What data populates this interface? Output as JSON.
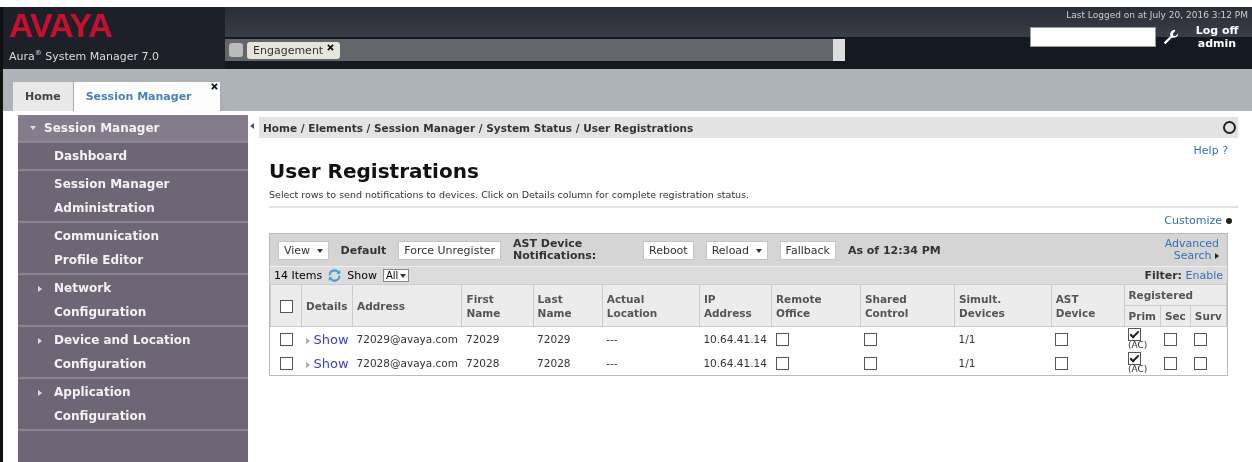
{
  "header": {
    "logo": "AVAYA",
    "product": "Aura",
    "product_mark": "®",
    "product_rest": " System Manager 7.0",
    "tabs": [
      {
        "label": "Engagement"
      }
    ],
    "last_login": "Last Logged on at July 20, 2016 3:12 PM",
    "logoff": "Log off",
    "user": "admin"
  },
  "tabs": [
    {
      "label": "Home",
      "selected": false,
      "closable": false
    },
    {
      "label": "Session Manager",
      "selected": true,
      "closable": true
    }
  ],
  "sidebar": {
    "items": [
      {
        "label": "Session Manager",
        "kind": "group",
        "expanded": true
      },
      {
        "label": "Dashboard",
        "kind": "item"
      },
      {
        "label": "Session Manager Administration",
        "kind": "item"
      },
      {
        "label": "Communication Profile Editor",
        "kind": "item"
      },
      {
        "label": "Network Configuration",
        "kind": "group",
        "expanded": false
      },
      {
        "label": "Device and Location Configuration",
        "kind": "group",
        "expanded": false
      },
      {
        "label": "Application Configuration",
        "kind": "group",
        "expanded": false
      }
    ]
  },
  "breadcrumb": "Home / Elements / Session Manager / System Status / User Registrations",
  "help": "Help ?",
  "title": "User Registrations",
  "description": "Select rows to send notifications to devices. Click on Details column for complete registration status.",
  "customize": "Customize",
  "toolbar": {
    "view": "View",
    "default": "Default",
    "force": "Force Unregister",
    "ast_label": "AST Device Notifications:",
    "reboot": "Reboot",
    "reload": "Reload",
    "failback": "Fallback",
    "as_of": "As of 12:34 PM",
    "advanced": "Advanced Search"
  },
  "items_bar": {
    "count": "14 Items",
    "show": "Show",
    "show_value": "All",
    "filter": "Filter:",
    "filter_link": "Enable"
  },
  "table": {
    "select_all": false,
    "columns": [
      "Details",
      "Address",
      "First Name",
      "Last Name",
      "Actual Location",
      "IP Address",
      "Remote Office",
      "Shared Control",
      "Simult. Devices",
      "AST Device"
    ],
    "registered": "Registered",
    "sub_columns": [
      "Prim",
      "Sec",
      "Surv"
    ],
    "rows": [
      {
        "checked": false,
        "details": "Show",
        "address": "72029@avaya.com",
        "first": "72029",
        "last": "72029",
        "location": "---",
        "ip": "10.64.41.14",
        "remote_office": false,
        "shared_control": false,
        "simult": "1/1",
        "ast_device": false,
        "prim": true,
        "prim_note": "(AC)",
        "sec": false,
        "surv": false
      },
      {
        "checked": false,
        "details": "Show",
        "address": "72028@avaya.com",
        "first": "72028",
        "last": "72028",
        "location": "---",
        "ip": "10.64.41.14",
        "remote_office": false,
        "shared_control": false,
        "simult": "1/1",
        "ast_device": false,
        "prim": true,
        "prim_note": "(AC)",
        "sec": false,
        "surv": false
      }
    ]
  }
}
